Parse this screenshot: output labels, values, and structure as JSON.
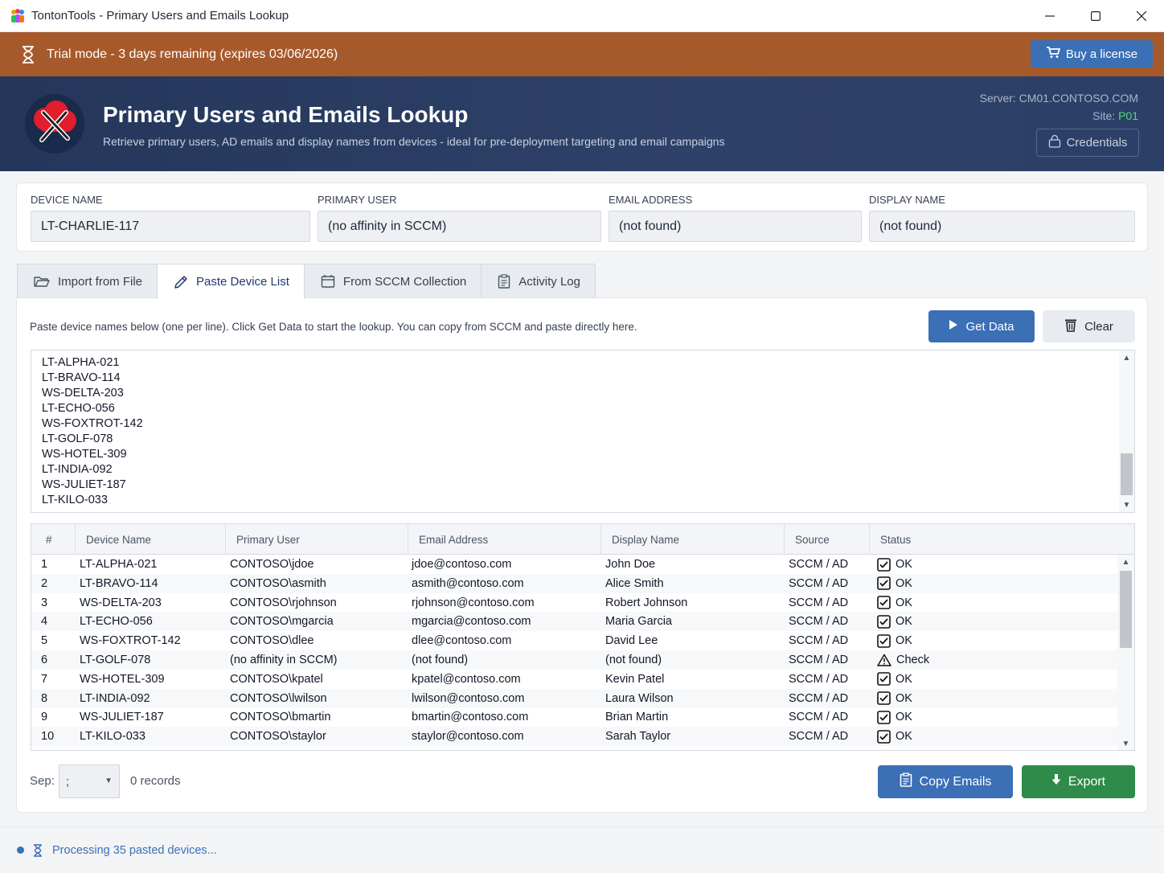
{
  "window": {
    "title": "TontonTools - Primary Users and Emails Lookup",
    "app_icon": "people-icon",
    "controls": [
      "minimize-icon",
      "maximize-icon",
      "close-icon"
    ]
  },
  "trial": {
    "text": "Trial mode - 3 days remaining (expires 03/06/2026)",
    "icon": "hourglass-icon",
    "buy_label": "Buy a license"
  },
  "header": {
    "title": "Primary Users and Emails Lookup",
    "subtitle": "Retrieve primary users, AD emails and display names from devices - ideal for pre-deployment targeting and email campaigns",
    "server": "Server: CM01.CONTOSO.COM",
    "site_label": "Site:",
    "site_value": "P01",
    "credentials_label": "Credentials",
    "colors": {
      "bg": "#24365a",
      "site": "#4ade80"
    }
  },
  "info": {
    "device_name": {
      "label": "DEVICE NAME",
      "value": "LT-CHARLIE-117"
    },
    "primary_user": {
      "label": "PRIMARY USER",
      "value": "(no affinity in SCCM)"
    },
    "email_address": {
      "label": "EMAIL ADDRESS",
      "value": "(not found)"
    },
    "display_name": {
      "label": "DISPLAY NAME",
      "value": "(not found)"
    }
  },
  "tabs": [
    {
      "label": "Import from File",
      "icon": "folder-open-icon",
      "active": false
    },
    {
      "label": "Paste Device List",
      "icon": "pencil-icon",
      "active": true
    },
    {
      "label": "From SCCM Collection",
      "icon": "calendar-icon",
      "active": false
    },
    {
      "label": "Activity Log",
      "icon": "clipboard-icon",
      "active": false
    }
  ],
  "paste": {
    "instructions": "Paste device names below (one per line). Click Get Data to start the lookup. You can copy from SCCM and paste directly here.",
    "get_data_label": "Get Data",
    "clear_label": "Clear",
    "lines": [
      "LT-ALPHA-021",
      "LT-BRAVO-114",
      "WS-DELTA-203",
      "LT-ECHO-056",
      "WS-FOXTROT-142",
      "LT-GOLF-078",
      "WS-HOTEL-309",
      "LT-INDIA-092",
      "WS-JULIET-187",
      "LT-KILO-033"
    ]
  },
  "table": {
    "columns": [
      "#",
      "Device Name",
      "Primary User",
      "Email Address",
      "Display Name",
      "Source",
      "Status"
    ],
    "rows": [
      {
        "num": "1",
        "device": "LT-ALPHA-021",
        "user": "CONTOSO\\jdoe",
        "email": "jdoe@contoso.com",
        "display": "John Doe",
        "source": "SCCM / AD",
        "status": "OK",
        "status_icon": "checkbox-icon"
      },
      {
        "num": "2",
        "device": "LT-BRAVO-114",
        "user": "CONTOSO\\asmith",
        "email": "asmith@contoso.com",
        "display": "Alice Smith",
        "source": "SCCM / AD",
        "status": "OK",
        "status_icon": "checkbox-icon"
      },
      {
        "num": "3",
        "device": "WS-DELTA-203",
        "user": "CONTOSO\\rjohnson",
        "email": "rjohnson@contoso.com",
        "display": "Robert Johnson",
        "source": "SCCM / AD",
        "status": "OK",
        "status_icon": "checkbox-icon"
      },
      {
        "num": "4",
        "device": "LT-ECHO-056",
        "user": "CONTOSO\\mgarcia",
        "email": "mgarcia@contoso.com",
        "display": "Maria Garcia",
        "source": "SCCM / AD",
        "status": "OK",
        "status_icon": "checkbox-icon"
      },
      {
        "num": "5",
        "device": "WS-FOXTROT-142",
        "user": "CONTOSO\\dlee",
        "email": "dlee@contoso.com",
        "display": "David Lee",
        "source": "SCCM / AD",
        "status": "OK",
        "status_icon": "checkbox-icon"
      },
      {
        "num": "6",
        "device": "LT-GOLF-078",
        "user": "(no affinity in SCCM)",
        "email": "(not found)",
        "display": "(not found)",
        "source": "SCCM / AD",
        "status": "Check",
        "status_icon": "warning-icon"
      },
      {
        "num": "7",
        "device": "WS-HOTEL-309",
        "user": "CONTOSO\\kpatel",
        "email": "kpatel@contoso.com",
        "display": "Kevin Patel",
        "source": "SCCM / AD",
        "status": "OK",
        "status_icon": "checkbox-icon"
      },
      {
        "num": "8",
        "device": "LT-INDIA-092",
        "user": "CONTOSO\\lwilson",
        "email": "lwilson@contoso.com",
        "display": "Laura Wilson",
        "source": "SCCM / AD",
        "status": "OK",
        "status_icon": "checkbox-icon"
      },
      {
        "num": "9",
        "device": "WS-JULIET-187",
        "user": "CONTOSO\\bmartin",
        "email": "bmartin@contoso.com",
        "display": "Brian Martin",
        "source": "SCCM / AD",
        "status": "OK",
        "status_icon": "checkbox-icon"
      },
      {
        "num": "10",
        "device": "LT-KILO-033",
        "user": "CONTOSO\\staylor",
        "email": "staylor@contoso.com",
        "display": "Sarah Taylor",
        "source": "SCCM / AD",
        "status": "OK",
        "status_icon": "checkbox-icon"
      }
    ]
  },
  "footer": {
    "sep_label": "Sep:",
    "sep_value": ";",
    "records": "0 records",
    "copy_label": "Copy Emails",
    "export_label": "Export",
    "colors": {
      "copy": "#3b6fb6",
      "export": "#2e8b4a"
    }
  },
  "status": {
    "text": "Processing 35 pasted devices..."
  }
}
